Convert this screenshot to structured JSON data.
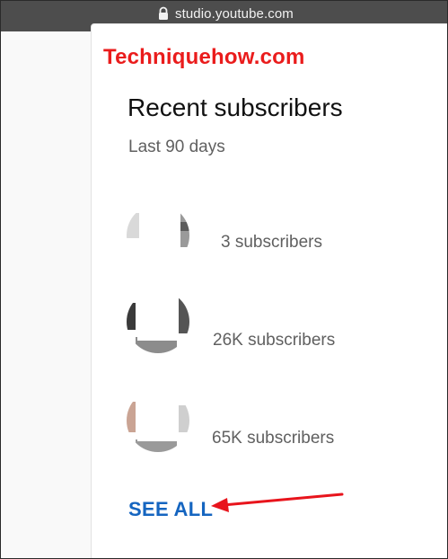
{
  "browser": {
    "url": "studio.youtube.com"
  },
  "watermark": "Techniquehow.com",
  "card": {
    "title": "Recent subscribers",
    "subtitle": "Last 90 days",
    "subscribers": [
      {
        "name": "",
        "count": "3 subscribers"
      },
      {
        "name": "",
        "count": "26K subscribers"
      },
      {
        "name": "",
        "count": "65K subscribers"
      }
    ],
    "see_all_label": "SEE ALL"
  },
  "colors": {
    "annotation_arrow": "#e8141c",
    "link": "#1565c0",
    "watermark": "#ea1c1c"
  }
}
